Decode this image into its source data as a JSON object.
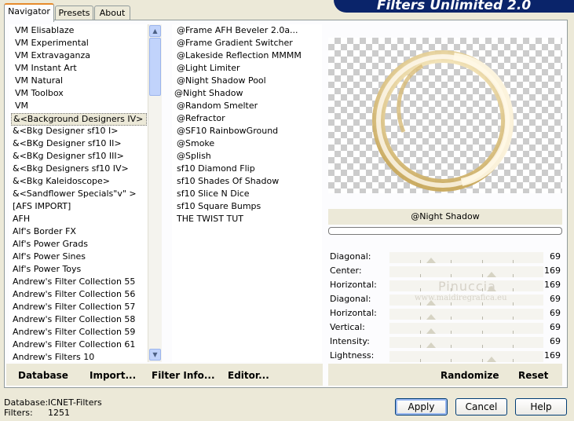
{
  "header": {
    "title": "Filters Unlimited 2.0"
  },
  "tabs": [
    {
      "label": "Navigator",
      "active": true
    },
    {
      "label": "Presets",
      "active": false
    },
    {
      "label": "About",
      "active": false
    }
  ],
  "categories": [
    "VM Elisablaze",
    "VM Experimental",
    "VM Extravaganza",
    "VM Instant Art",
    "VM Natural",
    "VM Toolbox",
    "VM",
    "&<Background Designers IV>",
    "&<Bkg Designer sf10 I>",
    "&<BKg Designer sf10 II>",
    "&<BKg Designer sf10 III>",
    "&<Bkg Designers sf10 IV>",
    "&<Bkg Kaleidoscope>",
    "&<Sandflower Specials\"v\" >",
    "[AFS IMPORT]",
    "AFH",
    "Alf's Border FX",
    "Alf's Power Grads",
    "Alf's Power Sines",
    "Alf's Power Toys",
    "Andrew's Filter Collection 55",
    "Andrew's Filter Collection 56",
    "Andrew's Filter Collection 57",
    "Andrew's Filter Collection 58",
    "Andrew's Filter Collection 59",
    "Andrew's Filter Collection 61",
    "Andrew's Filters 10"
  ],
  "selected_category": "&<Background Designers IV>",
  "filters": [
    "@Frame AFH Beveler 2.0a...",
    "@Frame Gradient Switcher",
    "@Lakeside Reflection MMMM",
    "@Light Limiter",
    "@Night Shadow Pool",
    "@Night Shadow",
    "@Random Smelter",
    "@Refractor",
    "@SF10 RainbowGround",
    "@Smoke",
    "@Splish",
    "sf10 Diamond Flip",
    "sf10 Shades Of Shadow",
    "sf10 Slice N Dice",
    "sf10 Square Bumps",
    "THE TWIST TUT"
  ],
  "selected_filter": "@Night Shadow",
  "left_buttons": {
    "database": "Database",
    "import": "Import...",
    "filter_info": "Filter Info...",
    "editor": "Editor..."
  },
  "preview": {
    "filter_name": "@Night Shadow"
  },
  "sliders": [
    {
      "label": "Diagonal:",
      "value": "69",
      "level": 69
    },
    {
      "label": "Center:",
      "value": "169",
      "level": 169
    },
    {
      "label": "Horizontal:",
      "value": "169",
      "level": 169
    },
    {
      "label": "Diagonal:",
      "value": "69",
      "level": 69
    },
    {
      "label": "Horizontal:",
      "value": "69",
      "level": 69
    },
    {
      "label": "Vertical:",
      "value": "69",
      "level": 69
    },
    {
      "label": "Intensity:",
      "value": "69",
      "level": 69
    },
    {
      "label": "Lightness:",
      "value": "169",
      "level": 169
    }
  ],
  "right_buttons": {
    "randomize": "Randomize",
    "reset": "Reset"
  },
  "watermark": {
    "line1": "Pinuccia",
    "line2": "www.maidiregrafica.eu"
  },
  "status": {
    "database_label": "Database:",
    "database_value": "ICNET-Filters",
    "filters_label": "Filters:",
    "filters_value": "1251"
  },
  "dialog_buttons": {
    "apply": "Apply",
    "cancel": "Cancel",
    "help": "Help"
  }
}
